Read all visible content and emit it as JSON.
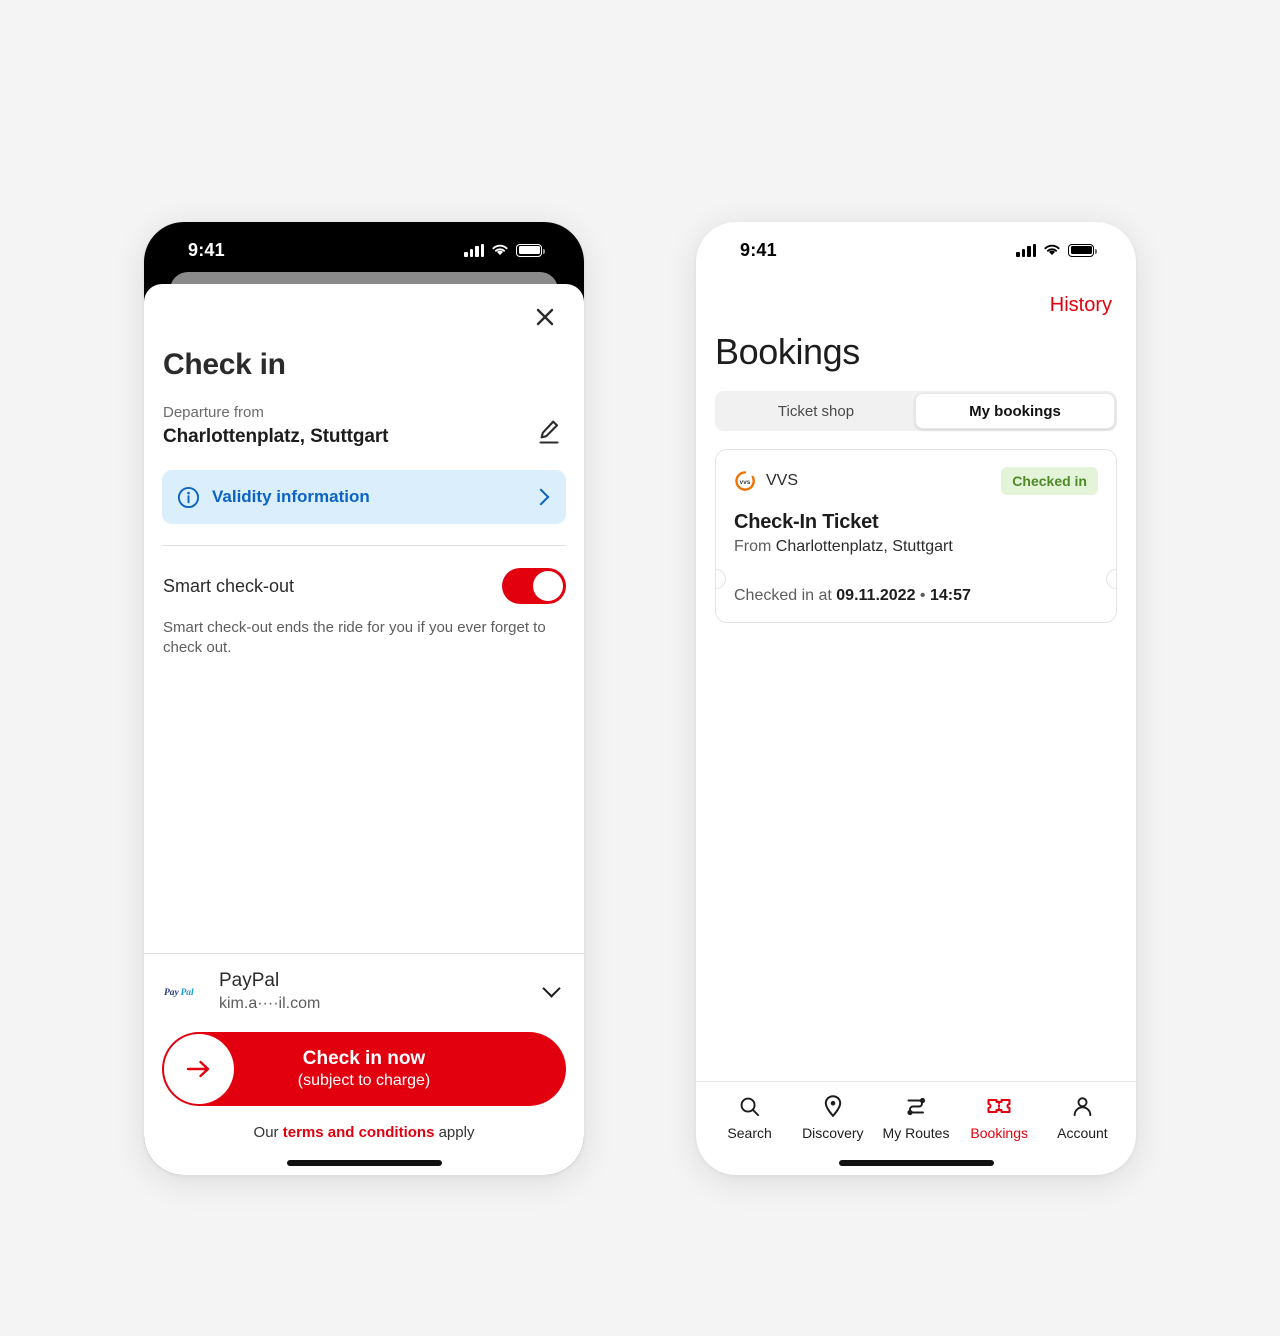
{
  "theme": {
    "brand_red": "#e2000f",
    "info_blue": "#0b63c5",
    "badge_green": "#4f8a27",
    "badge_bg": "#e4f4d8"
  },
  "left_phone": {
    "status": {
      "time": "9:41",
      "signal": "signal-icon",
      "wifi": "wifi-icon",
      "battery": "battery-icon"
    },
    "sheet": {
      "close": "✕",
      "title": "Check in",
      "departure_label": "Departure from",
      "departure_value": "Charlottenplatz, Stuttgart",
      "edit_icon": "pencil-icon",
      "info_banner": {
        "icon": "info-icon",
        "label": "Validity information",
        "chevron": "chevron-right-icon"
      },
      "smart_checkout": {
        "label": "Smart check-out",
        "state": "on",
        "description": "Smart check-out ends the ride for you if you ever forget to check out."
      },
      "payment": {
        "provider_logo": "paypal-logo",
        "provider": "PayPal",
        "account": "kim.a····il.com",
        "chevron": "chevron-down-icon"
      },
      "cta": {
        "arrow": "arrow-right-icon",
        "main": "Check in now",
        "sub": "(subject to charge)"
      },
      "terms": {
        "prefix": "Our ",
        "link": "terms and conditions",
        "suffix": " apply"
      }
    }
  },
  "right_phone": {
    "status": {
      "time": "9:41",
      "signal": "signal-icon",
      "wifi": "wifi-icon",
      "battery": "battery-icon"
    },
    "history_link": "History",
    "title": "Bookings",
    "tabs": [
      {
        "label": "Ticket shop",
        "active": false
      },
      {
        "label": "My bookings",
        "active": true
      }
    ],
    "ticket": {
      "brand_logo": "vvs-logo",
      "brand": "VVS",
      "status_badge": "Checked in",
      "title": "Check-In Ticket",
      "from_label": "From ",
      "from_value": "Charlottenplatz, Stuttgart",
      "checked_label": "Checked in at ",
      "checked_date": "09.11.2022",
      "checked_sep": " • ",
      "checked_time": "14:57"
    },
    "tabbar": [
      {
        "label": "Search",
        "icon": "search-icon",
        "active": false
      },
      {
        "label": "Discovery",
        "icon": "map-pin-icon",
        "active": false
      },
      {
        "label": "My Routes",
        "icon": "route-icon",
        "active": false
      },
      {
        "label": "Bookings",
        "icon": "ticket-icon",
        "active": true
      },
      {
        "label": "Account",
        "icon": "person-icon",
        "active": false
      }
    ]
  }
}
